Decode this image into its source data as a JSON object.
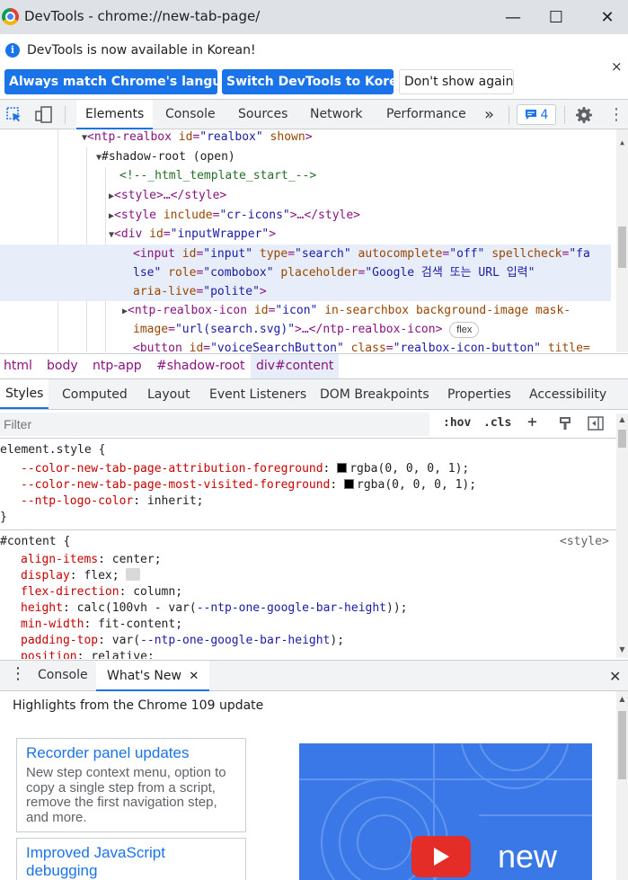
{
  "window": {
    "title": "DevTools - chrome://new-tab-page/",
    "minimize": "—",
    "maximize": "☐",
    "close": "✕"
  },
  "infobar": {
    "message": "DevTools is now available in Korean!",
    "btn_match": "Always match Chrome's language",
    "btn_switch": "Switch DevTools to Korean",
    "btn_dismiss": "Don't show again",
    "close": "×"
  },
  "toolbar": {
    "tabs": [
      "Elements",
      "Console",
      "Sources",
      "Network",
      "Performance"
    ],
    "more": "»",
    "issues_count": "4"
  },
  "dom": {
    "l1_tag": "<ntp-realbox",
    "l1_attr": "id",
    "l1_val": "\"realbox\"",
    "l1_attr2": "shown",
    "l1_end": ">",
    "l2": "#shadow-root (open)",
    "l3": "<!--_html_template_start_-->",
    "l4": "<style>…</style>",
    "l5_tag": "<style",
    "l5_attr": "include",
    "l5_val": "\"cr-icons\"",
    "l5_end": ">…</style>",
    "l6_tag": "<div",
    "l6_attr": "id",
    "l6_val": "\"inputWrapper\"",
    "l6_end": ">",
    "l7_tag": "<input",
    "l7_a1": "id",
    "l7_v1": "\"input\"",
    "l7_a2": "type",
    "l7_v2": "\"search\"",
    "l7_a3": "autocomplete",
    "l7_v3": "\"off\"",
    "l7_a4": "spellcheck",
    "l7_v4a": "\"fa",
    "l8_v4b": "lse\"",
    "l8_a5": "role",
    "l8_v5": "\"combobox\"",
    "l8_a6": "placeholder",
    "l8_v6": "\"Google 검색 또는 URL 입력\"",
    "l9_a7": "aria-live",
    "l9_v7": "\"polite\"",
    "l9_end": ">",
    "l10_tag": "<ntp-realbox-icon",
    "l10_a1": "id",
    "l10_v1": "\"icon\"",
    "l10_a2": "in-searchbox background-image mask-",
    "l11_a2b": "image",
    "l11_v2": "\"url(search.svg)\"",
    "l11_end": ">…</ntp-realbox-icon>",
    "l11_pill": "flex",
    "l12_tag": "<button",
    "l12_a1": "id",
    "l12_v1": "\"voiceSearchButton\"",
    "l12_a2": "class",
    "l12_v2": "\"realbox-icon-button\"",
    "l12_a3": "title="
  },
  "breadcrumb": [
    "html",
    "body",
    "ntp-app",
    "#shadow-root",
    "div#content"
  ],
  "styles_tabs": [
    "Styles",
    "Computed",
    "Layout",
    "Event Listeners",
    "DOM Breakpoints",
    "Properties",
    "Accessibility"
  ],
  "filter": {
    "placeholder": "Filter",
    "hov": ":hov",
    "cls": ".cls",
    "plus": "+"
  },
  "styles": {
    "rule1_selector": "element.style {",
    "rule1_props": [
      {
        "name": "--color-new-tab-page-attribution-foreground",
        "value": "rgba(0, 0, 0, 1);"
      },
      {
        "name": "--color-new-tab-page-most-visited-foreground",
        "value": "rgba(0, 0, 0, 1);"
      },
      {
        "name": "--ntp-logo-color",
        "value": "inherit;"
      }
    ],
    "close_brace": "}",
    "rule2_selector": "#content {",
    "rule2_source": "<style>",
    "align_items": {
      "name": "align-items",
      "value": "center;"
    },
    "display": {
      "name": "display",
      "value": "flex;"
    },
    "flex_direction": {
      "name": "flex-direction",
      "value": "column;"
    },
    "height": {
      "name": "height",
      "pre": "calc(100vh - var(",
      "var": "--ntp-one-google-bar-height",
      "post": "));"
    },
    "min_width": {
      "name": "min-width",
      "value": "fit-content;"
    },
    "padding_top": {
      "name": "padding-top",
      "pre": "var(",
      "var": "--ntp-one-google-bar-height",
      "post": ");"
    },
    "position": {
      "name": "position",
      "value": "relative;"
    }
  },
  "drawer": {
    "more": "⋮",
    "tab_console": "Console",
    "tab_whatsnew": "What's New",
    "tab_close": "✕",
    "close": "✕"
  },
  "whatsnew": {
    "header": "Highlights from the Chrome 109 update",
    "card1_title": "Recorder panel updates",
    "card1_desc": "New step context menu, option to copy a single step from a script, remove the first navigation step, and more.",
    "card2_title": "Improved JavaScript debugging",
    "video_label": "new"
  },
  "colors": {
    "accent": "#1a73e8",
    "tag": "#881280",
    "attr": "#994500",
    "value": "#1a1aa6",
    "comment": "#236e25",
    "css_prop": "#c80000"
  }
}
